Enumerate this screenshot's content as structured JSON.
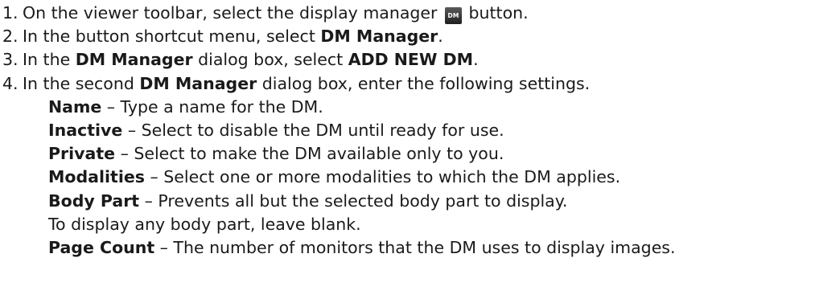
{
  "steps": [
    {
      "num": "1.",
      "pre": "On the viewer toolbar, select the display manager ",
      "icon": "dm-icon",
      "icon_text": "DM",
      "post": " button."
    },
    {
      "num": "2.",
      "pre": "In the button shortcut menu, select ",
      "bold": "DM Manager",
      "post": "."
    },
    {
      "num": "3.",
      "pre": "In the ",
      "bold1": "DM Manager",
      "mid": " dialog box, select ",
      "bold2": "ADD NEW DM",
      "post": "."
    },
    {
      "num": "4.",
      "pre": "In the second ",
      "bold": "DM Manager",
      "post": " dialog box, enter the following settings."
    }
  ],
  "settings": [
    {
      "term": "Name",
      "desc": " – Type a name for the DM."
    },
    {
      "term": "Inactive",
      "desc": " – Select to disable the DM until ready for use."
    },
    {
      "term": "Private",
      "desc": " – Select to make the DM available only to you."
    },
    {
      "term": "Modalities",
      "desc": " – Select one or more modalities to which the DM applies."
    },
    {
      "term": "Body Part",
      "desc": " – Prevents all but the selected body part to display."
    }
  ],
  "body_part_note": "To display any body part, leave blank.",
  "page_count": {
    "term": "Page Count",
    "desc": " – The number of monitors that the DM uses to display images."
  }
}
